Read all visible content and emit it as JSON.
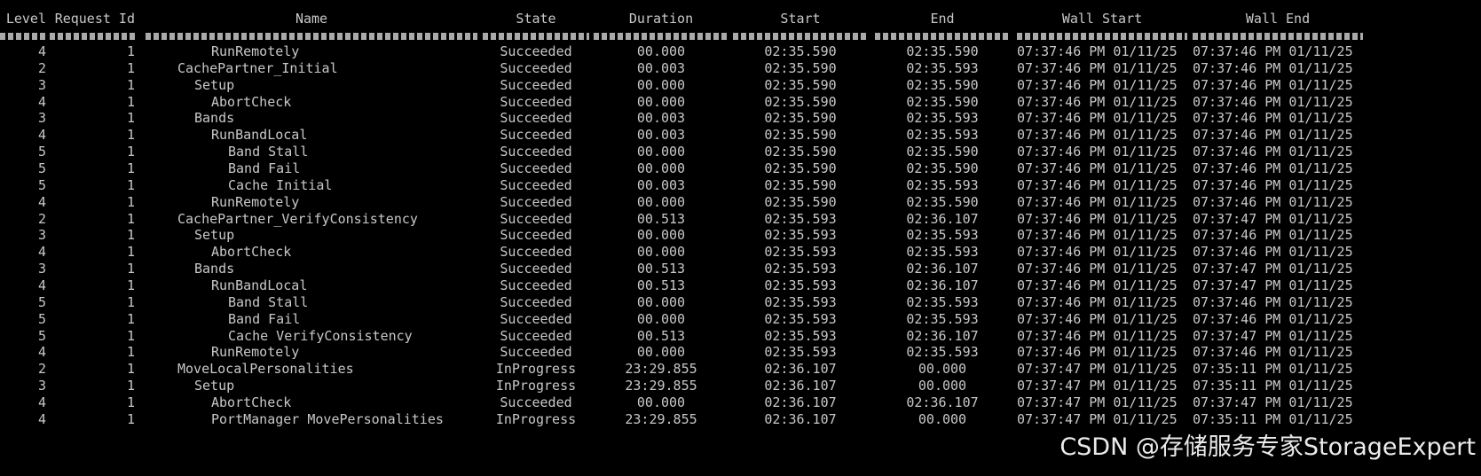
{
  "columns": [
    "Level",
    "Request Id",
    "Name",
    "State",
    "Duration",
    "Start",
    "End",
    "Wall Start",
    "Wall End"
  ],
  "rows": [
    {
      "level": "4",
      "request_id": "1",
      "name": "RunRemotely",
      "state": "Succeeded",
      "duration": "00.000",
      "start": "02:35.590",
      "end": "02:35.590",
      "wall_start": "07:37:46 PM 01/11/25",
      "wall_end": "07:37:46 PM 01/11/25"
    },
    {
      "level": "2",
      "request_id": "1",
      "name": "CachePartner_Initial",
      "state": "Succeeded",
      "duration": "00.003",
      "start": "02:35.590",
      "end": "02:35.593",
      "wall_start": "07:37:46 PM 01/11/25",
      "wall_end": "07:37:46 PM 01/11/25"
    },
    {
      "level": "3",
      "request_id": "1",
      "name": "Setup",
      "state": "Succeeded",
      "duration": "00.000",
      "start": "02:35.590",
      "end": "02:35.590",
      "wall_start": "07:37:46 PM 01/11/25",
      "wall_end": "07:37:46 PM 01/11/25"
    },
    {
      "level": "4",
      "request_id": "1",
      "name": "AbortCheck",
      "state": "Succeeded",
      "duration": "00.000",
      "start": "02:35.590",
      "end": "02:35.590",
      "wall_start": "07:37:46 PM 01/11/25",
      "wall_end": "07:37:46 PM 01/11/25"
    },
    {
      "level": "3",
      "request_id": "1",
      "name": "Bands",
      "state": "Succeeded",
      "duration": "00.003",
      "start": "02:35.590",
      "end": "02:35.593",
      "wall_start": "07:37:46 PM 01/11/25",
      "wall_end": "07:37:46 PM 01/11/25"
    },
    {
      "level": "4",
      "request_id": "1",
      "name": "RunBandLocal",
      "state": "Succeeded",
      "duration": "00.003",
      "start": "02:35.590",
      "end": "02:35.593",
      "wall_start": "07:37:46 PM 01/11/25",
      "wall_end": "07:37:46 PM 01/11/25"
    },
    {
      "level": "5",
      "request_id": "1",
      "name": "Band Stall",
      "state": "Succeeded",
      "duration": "00.000",
      "start": "02:35.590",
      "end": "02:35.590",
      "wall_start": "07:37:46 PM 01/11/25",
      "wall_end": "07:37:46 PM 01/11/25"
    },
    {
      "level": "5",
      "request_id": "1",
      "name": "Band Fail",
      "state": "Succeeded",
      "duration": "00.000",
      "start": "02:35.590",
      "end": "02:35.590",
      "wall_start": "07:37:46 PM 01/11/25",
      "wall_end": "07:37:46 PM 01/11/25"
    },
    {
      "level": "5",
      "request_id": "1",
      "name": "Cache Initial",
      "state": "Succeeded",
      "duration": "00.003",
      "start": "02:35.590",
      "end": "02:35.593",
      "wall_start": "07:37:46 PM 01/11/25",
      "wall_end": "07:37:46 PM 01/11/25"
    },
    {
      "level": "4",
      "request_id": "1",
      "name": "RunRemotely",
      "state": "Succeeded",
      "duration": "00.000",
      "start": "02:35.590",
      "end": "02:35.590",
      "wall_start": "07:37:46 PM 01/11/25",
      "wall_end": "07:37:46 PM 01/11/25"
    },
    {
      "level": "2",
      "request_id": "1",
      "name": "CachePartner_VerifyConsistency",
      "state": "Succeeded",
      "duration": "00.513",
      "start": "02:35.593",
      "end": "02:36.107",
      "wall_start": "07:37:46 PM 01/11/25",
      "wall_end": "07:37:47 PM 01/11/25"
    },
    {
      "level": "3",
      "request_id": "1",
      "name": "Setup",
      "state": "Succeeded",
      "duration": "00.000",
      "start": "02:35.593",
      "end": "02:35.593",
      "wall_start": "07:37:46 PM 01/11/25",
      "wall_end": "07:37:46 PM 01/11/25"
    },
    {
      "level": "4",
      "request_id": "1",
      "name": "AbortCheck",
      "state": "Succeeded",
      "duration": "00.000",
      "start": "02:35.593",
      "end": "02:35.593",
      "wall_start": "07:37:46 PM 01/11/25",
      "wall_end": "07:37:46 PM 01/11/25"
    },
    {
      "level": "3",
      "request_id": "1",
      "name": "Bands",
      "state": "Succeeded",
      "duration": "00.513",
      "start": "02:35.593",
      "end": "02:36.107",
      "wall_start": "07:37:46 PM 01/11/25",
      "wall_end": "07:37:47 PM 01/11/25"
    },
    {
      "level": "4",
      "request_id": "1",
      "name": "RunBandLocal",
      "state": "Succeeded",
      "duration": "00.513",
      "start": "02:35.593",
      "end": "02:36.107",
      "wall_start": "07:37:46 PM 01/11/25",
      "wall_end": "07:37:47 PM 01/11/25"
    },
    {
      "level": "5",
      "request_id": "1",
      "name": "Band Stall",
      "state": "Succeeded",
      "duration": "00.000",
      "start": "02:35.593",
      "end": "02:35.593",
      "wall_start": "07:37:46 PM 01/11/25",
      "wall_end": "07:37:46 PM 01/11/25"
    },
    {
      "level": "5",
      "request_id": "1",
      "name": "Band Fail",
      "state": "Succeeded",
      "duration": "00.000",
      "start": "02:35.593",
      "end": "02:35.593",
      "wall_start": "07:37:46 PM 01/11/25",
      "wall_end": "07:37:46 PM 01/11/25"
    },
    {
      "level": "5",
      "request_id": "1",
      "name": "Cache VerifyConsistency",
      "state": "Succeeded",
      "duration": "00.513",
      "start": "02:35.593",
      "end": "02:36.107",
      "wall_start": "07:37:46 PM 01/11/25",
      "wall_end": "07:37:47 PM 01/11/25"
    },
    {
      "level": "4",
      "request_id": "1",
      "name": "RunRemotely",
      "state": "Succeeded",
      "duration": "00.000",
      "start": "02:35.593",
      "end": "02:35.593",
      "wall_start": "07:37:46 PM 01/11/25",
      "wall_end": "07:37:46 PM 01/11/25"
    },
    {
      "level": "2",
      "request_id": "1",
      "name": "MoveLocalPersonalities",
      "state": "InProgress",
      "duration": "23:29.855",
      "start": "02:36.107",
      "end": "00.000",
      "wall_start": "07:37:47 PM 01/11/25",
      "wall_end": "07:35:11 PM 01/11/25"
    },
    {
      "level": "3",
      "request_id": "1",
      "name": "Setup",
      "state": "InProgress",
      "duration": "23:29.855",
      "start": "02:36.107",
      "end": "00.000",
      "wall_start": "07:37:47 PM 01/11/25",
      "wall_end": "07:35:11 PM 01/11/25"
    },
    {
      "level": "4",
      "request_id": "1",
      "name": "AbortCheck",
      "state": "Succeeded",
      "duration": "00.000",
      "start": "02:36.107",
      "end": "02:36.107",
      "wall_start": "07:37:47 PM 01/11/25",
      "wall_end": "07:37:47 PM 01/11/25"
    },
    {
      "level": "4",
      "request_id": "1",
      "name": "PortManager MovePersonalities",
      "state": "InProgress",
      "duration": "23:29.855",
      "start": "02:36.107",
      "end": "00.000",
      "wall_start": "07:37:47 PM 01/11/25",
      "wall_end": "07:35:11 PM 01/11/25"
    }
  ],
  "watermark": "CSDN @存储服务专家StorageExpert"
}
